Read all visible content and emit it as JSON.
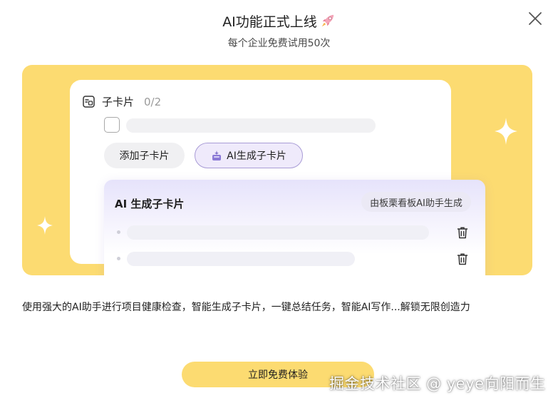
{
  "header": {
    "title": "AI功能正式上线",
    "title_icon": "rocket-icon",
    "subtitle": "每个企业免费试用50次",
    "close_icon": "close-icon"
  },
  "card": {
    "label": "子卡片",
    "count": "0/2",
    "add_button": "添加子卡片",
    "ai_button": "AI生成子卡片"
  },
  "ai_panel": {
    "title": "AI 生成子卡片",
    "tag": "由板栗看板AI助手生成"
  },
  "description": "使用强大的AI助手进行项目健康检查，智能生成子卡片，一键总结任务，智能AI写作...解锁无限创造力",
  "cta_button": "立即免费体验",
  "watermark": "掘金技术社区 @ yeye向阳而生",
  "colors": {
    "banner": "#fcdb71",
    "accent_purple": "#7d6cc8",
    "cta": "#fcdb71"
  }
}
